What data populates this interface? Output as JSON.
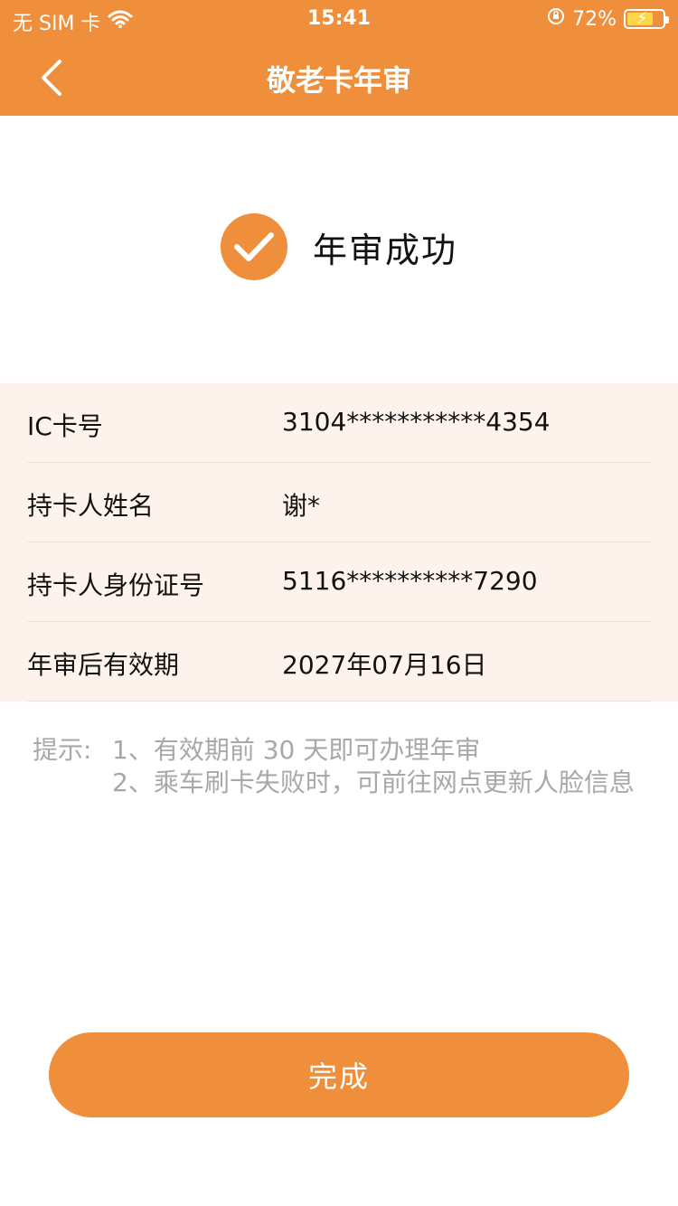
{
  "status_bar": {
    "carrier": "无 SIM 卡",
    "time": "15:41",
    "battery": "72%",
    "icons": [
      "wifi-icon",
      "rotation-lock-icon",
      "battery-charging-icon"
    ]
  },
  "header": {
    "title": "敬老卡年审",
    "back_icon": "chevron-left-icon",
    "color": "#EF8F3C"
  },
  "result": {
    "icon": "check-circle-icon",
    "text": "年审成功"
  },
  "info_rows": [
    {
      "label": "IC卡号",
      "value": "3104***********4354"
    },
    {
      "label": "持卡人姓名",
      "value": "谢*"
    },
    {
      "label": "持卡人身份证号",
      "value": "5116**********7290"
    },
    {
      "label": "年审后有效期",
      "value": "2027年07月16日"
    }
  ],
  "tips": {
    "label": "提示:",
    "lines": [
      "1、有效期前 30 天即可办理年审",
      "2、乘车刷卡失败时，可前往网点更新人脸信息"
    ]
  },
  "actions": {
    "done_label": "完成"
  }
}
